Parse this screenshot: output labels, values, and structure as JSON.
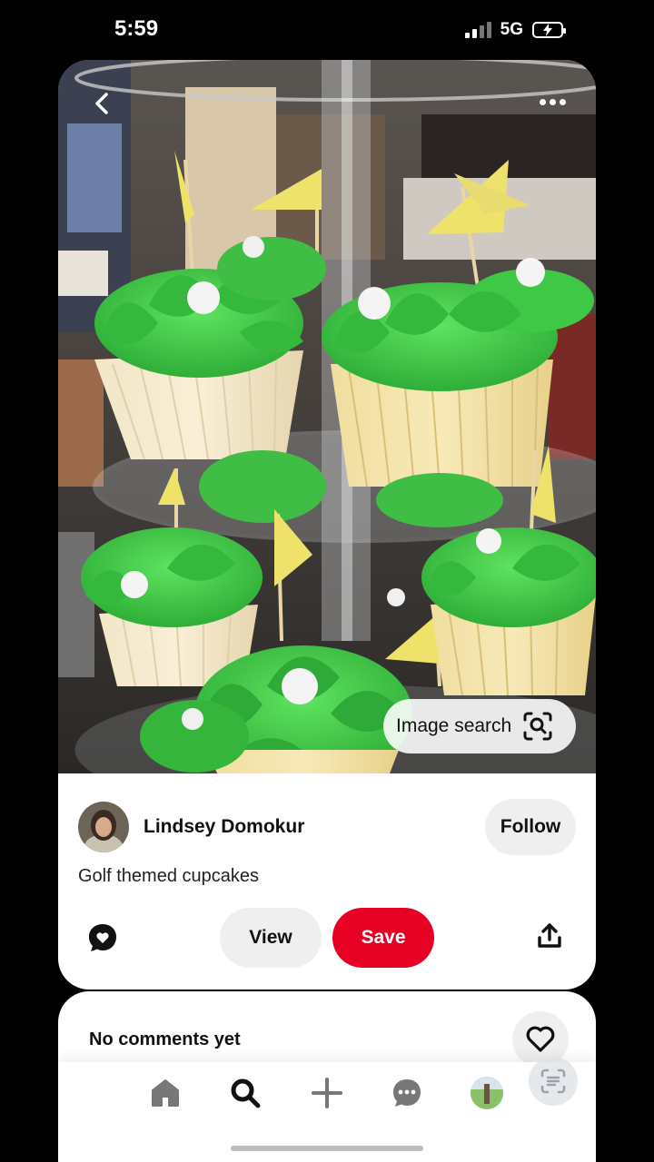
{
  "status": {
    "time": "5:59",
    "network": "5G"
  },
  "pin": {
    "image_search_label": "Image search",
    "creator_name": "Lindsey Domokur",
    "follow_label": "Follow",
    "description": "Golf themed cupcakes",
    "view_label": "View",
    "save_label": "Save"
  },
  "comments": {
    "title": "No comments yet"
  },
  "nav": {
    "items": [
      "home-icon",
      "search-icon",
      "plus-icon",
      "messages-icon",
      "profile-avatar"
    ],
    "active": "search-icon"
  },
  "colors": {
    "save_red": "#e60023",
    "frosting_green": "#3fcb45",
    "flag_yellow": "#efe26a"
  }
}
